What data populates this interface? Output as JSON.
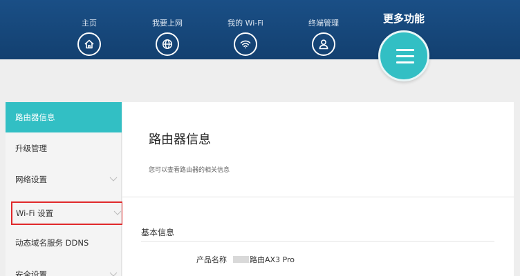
{
  "nav": {
    "items": [
      {
        "label": "主页",
        "icon": "home-icon"
      },
      {
        "label": "我要上网",
        "icon": "globe-icon"
      },
      {
        "label": "我的 Wi-Fi",
        "icon": "wifi-icon"
      },
      {
        "label": "终端管理",
        "icon": "user-icon"
      }
    ],
    "more_label": "更多功能",
    "more_icon": "menu-icon"
  },
  "sidebar": {
    "items": [
      {
        "label": "路由器信息",
        "active": true
      },
      {
        "label": "升级管理"
      },
      {
        "label": "网络设置",
        "expandable": true
      },
      {
        "label": "Wi-Fi 设置",
        "expandable": true,
        "highlighted": true
      },
      {
        "label": "动态域名服务 DDNS"
      },
      {
        "label": "安全设置",
        "expandable": true
      }
    ]
  },
  "main": {
    "title": "路由器信息",
    "description": "您可以查看路由器的相关信息",
    "section_title": "基本信息",
    "fields": [
      {
        "label": "产品名称",
        "value": "路由AX3 Pro"
      }
    ]
  },
  "colors": {
    "header": "#1a4f86",
    "accent": "#32bfc4",
    "highlight_box": "#e0282a"
  }
}
